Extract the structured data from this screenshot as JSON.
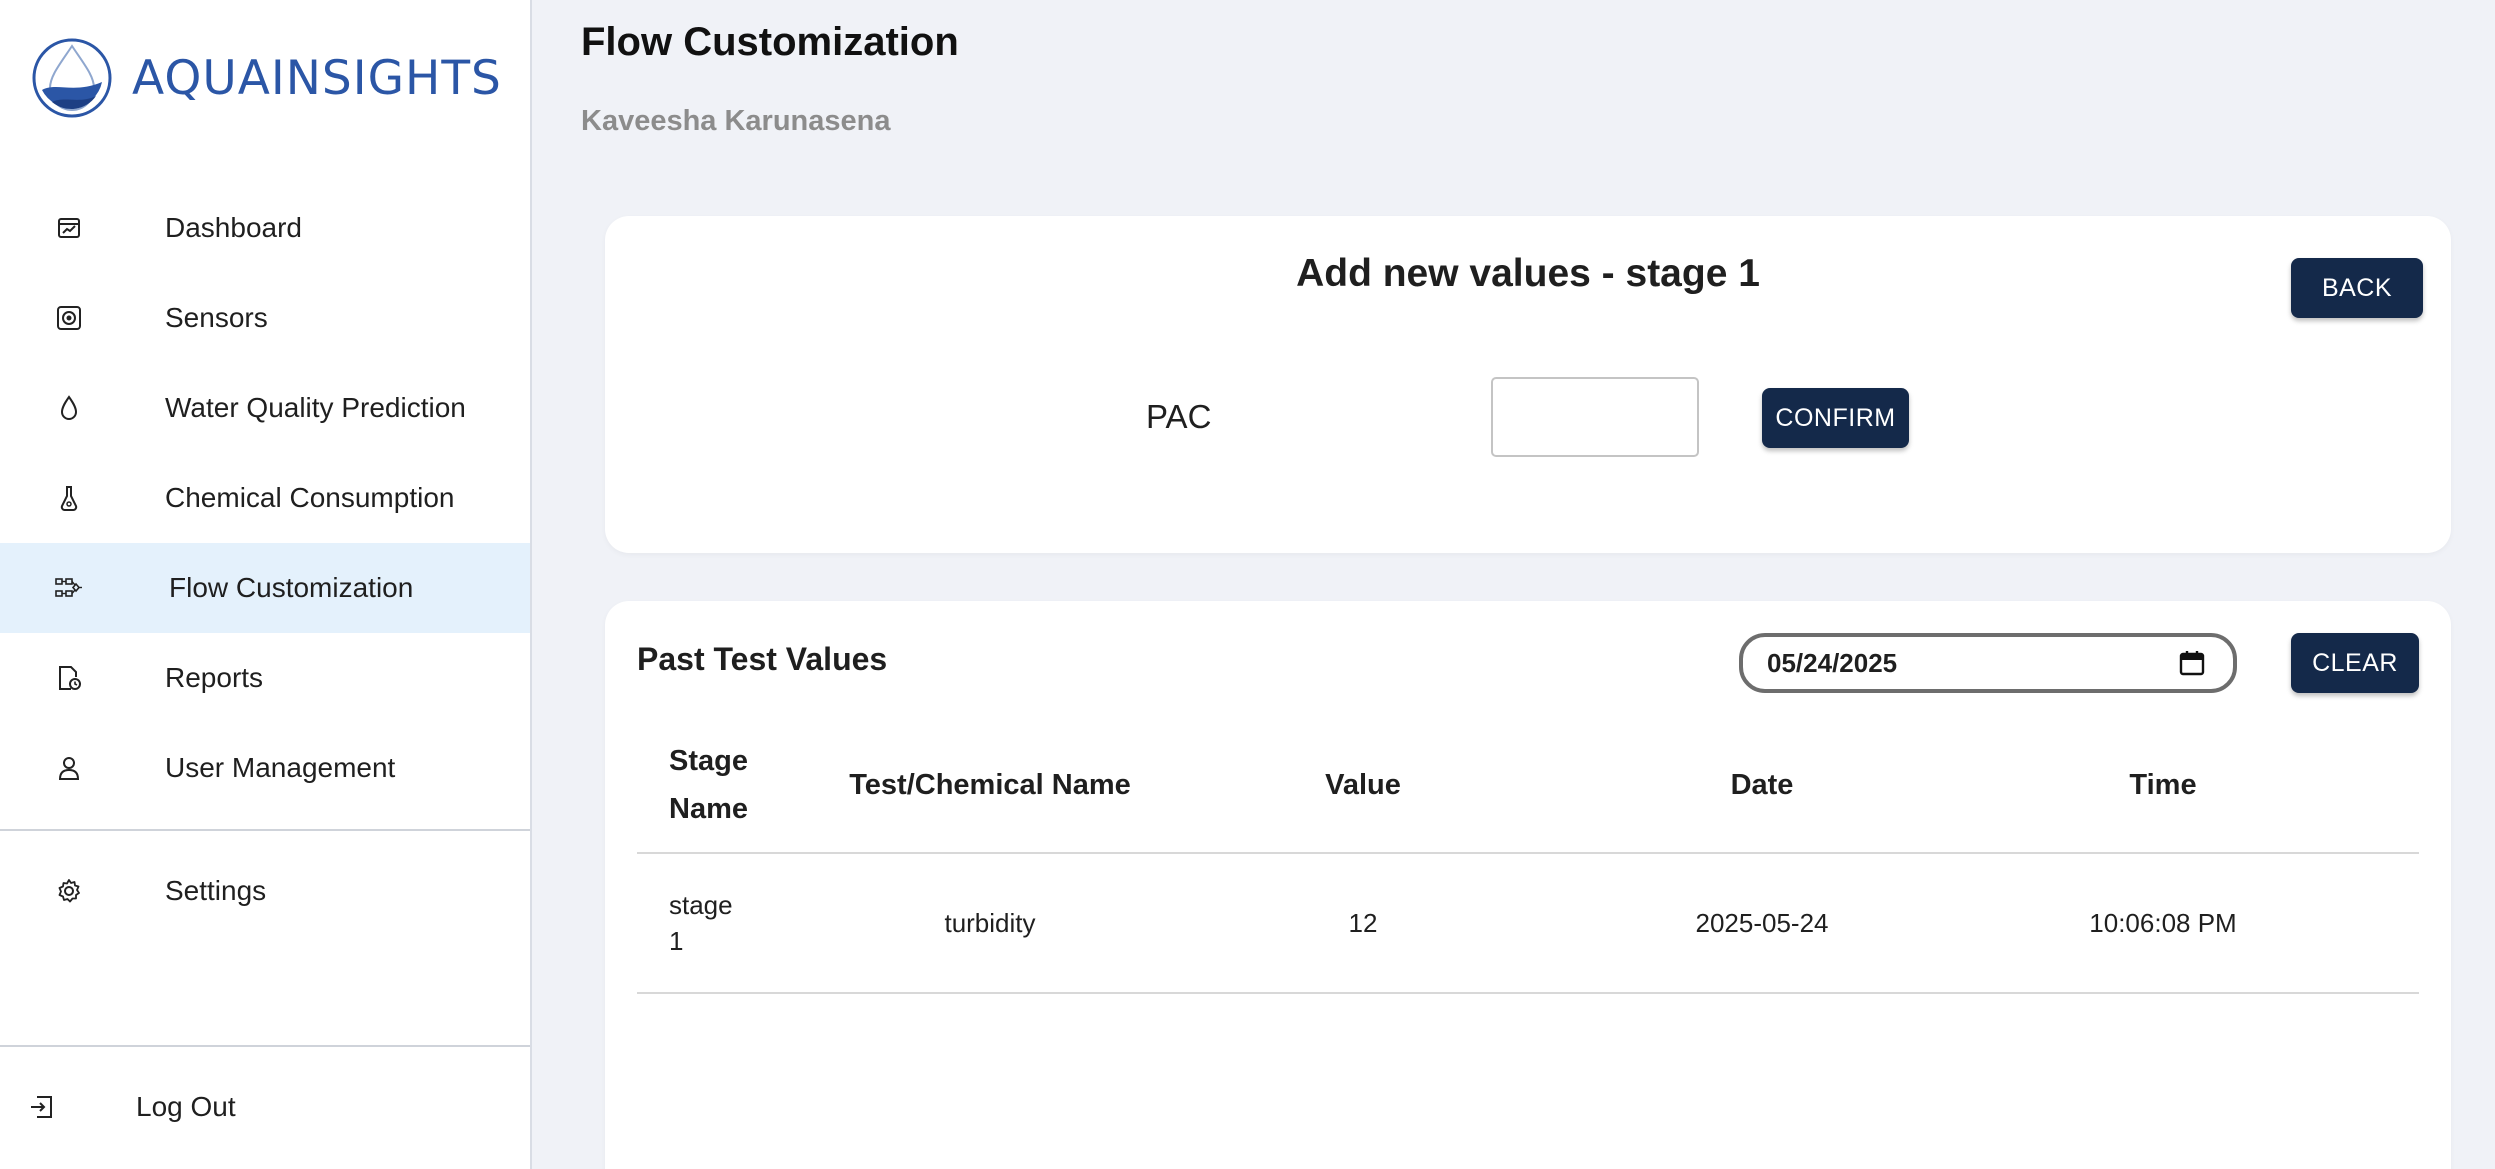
{
  "brand": {
    "name": "AQUAINSIGHTS",
    "color": "#2b56a6"
  },
  "sidebar": {
    "items": [
      {
        "label": "Dashboard",
        "icon": "chart-icon"
      },
      {
        "label": "Sensors",
        "icon": "sensor-icon"
      },
      {
        "label": "Water Quality Prediction",
        "icon": "droplet-icon"
      },
      {
        "label": "Chemical Consumption",
        "icon": "flask-icon"
      },
      {
        "label": "Flow Customization",
        "icon": "flow-icon",
        "active": true
      },
      {
        "label": "Reports",
        "icon": "report-icon"
      },
      {
        "label": "User Management",
        "icon": "user-icon"
      }
    ],
    "settings": {
      "label": "Settings",
      "icon": "gear-icon"
    },
    "logout": {
      "label": "Log Out",
      "icon": "logout-icon"
    }
  },
  "header": {
    "title": "Flow Customization",
    "user": "Kaveesha Karunasena"
  },
  "add_card": {
    "heading": "Add new values - stage 1",
    "back_label": "BACK",
    "field_label": "PAC",
    "field_value": "",
    "confirm_label": "CONFIRM"
  },
  "past_card": {
    "title": "Past Test Values",
    "date_value": "05/24/2025",
    "clear_label": "CLEAR",
    "columns": [
      "Stage Name",
      "Test/Chemical Name",
      "Value",
      "Date",
      "Time"
    ],
    "rows": [
      {
        "stage": "stage 1",
        "name": "turbidity",
        "value": "12",
        "date": "2025-05-24",
        "time": "10:06:08 PM"
      }
    ]
  },
  "colors": {
    "primary_button": "#14294a",
    "active_nav_bg": "#e4f1fc",
    "page_bg": "#f0f2f7"
  }
}
